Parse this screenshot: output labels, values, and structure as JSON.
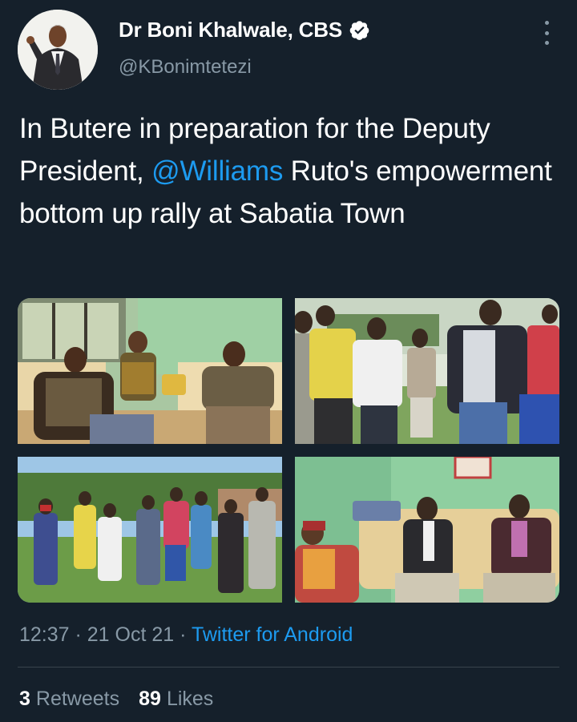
{
  "author": {
    "display_name": "Dr Boni Khalwale, CBS",
    "handle": "@KBonimtetezi",
    "verified": true
  },
  "tweet": {
    "text_part1": "In Butere in preparation for the Deputy President, ",
    "mention": "@Williams",
    "text_part2": " Ruto's empowerment bottom up rally at Sabatia Town"
  },
  "meta": {
    "time": "12:37",
    "separator1": " · ",
    "date": "21 Oct 21",
    "separator2": " · ",
    "source": "Twitter for Android"
  },
  "stats": {
    "retweets_count": "3",
    "retweets_label": "Retweets",
    "likes_count": "89",
    "likes_label": "Likes"
  },
  "colors": {
    "background": "#15202b",
    "link": "#1d9bf0",
    "secondary_text": "#8899a6",
    "divider": "#38444d"
  }
}
